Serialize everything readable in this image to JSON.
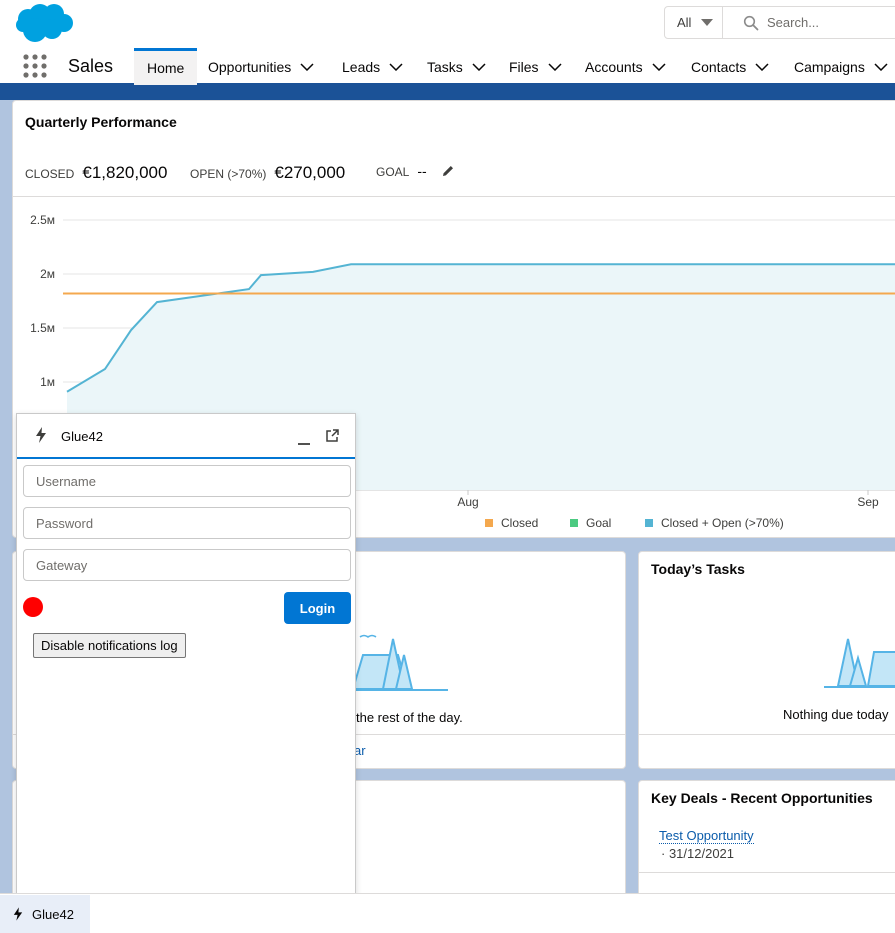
{
  "header": {
    "search_scope": "All",
    "search_placeholder": "Search..."
  },
  "nav": {
    "app_name": "Sales",
    "items": [
      {
        "label": "Home",
        "active": true
      },
      {
        "label": "Opportunities"
      },
      {
        "label": "Leads"
      },
      {
        "label": "Tasks"
      },
      {
        "label": "Files"
      },
      {
        "label": "Accounts"
      },
      {
        "label": "Contacts"
      },
      {
        "label": "Campaigns"
      }
    ]
  },
  "performance": {
    "title": "Quarterly Performance",
    "closed_label": "CLOSED",
    "closed_value": "€1,820,000",
    "open_label": "OPEN (>70%)",
    "open_value": "€270,000",
    "goal_label": "GOAL",
    "goal_value": "--"
  },
  "chart_data": {
    "type": "area",
    "ylim": [
      0,
      2500000
    ],
    "y_ticks": [
      1000000,
      1500000,
      2000000,
      2500000
    ],
    "y_tick_labels": [
      "1м",
      "1.5м",
      "2м",
      "2.5м"
    ],
    "x_tick_labels": [
      "Aug",
      "Sep"
    ],
    "legend": [
      "Closed",
      "Goal",
      "Closed + Open (>70%)"
    ],
    "legend_colors": [
      "#f4a84e",
      "#4bca81",
      "#54b4d3"
    ],
    "series": [
      {
        "name": "Closed",
        "values": [
          1820000,
          1820000
        ]
      },
      {
        "name": "Closed + Open (>70%)",
        "values": [
          910000,
          1120000,
          1480000,
          1740000,
          1860000,
          1990000,
          2020000,
          2090000,
          2090000
        ]
      }
    ]
  },
  "events": {
    "empty_message": "the rest of the day.",
    "footer_link": "ar"
  },
  "tasks": {
    "title": "Today’s Tasks",
    "empty_message": "Nothing due today"
  },
  "deals": {
    "title": "Key Deals - Recent Opportunities",
    "items": [
      {
        "name": "Test Opportunity",
        "date": "· 31/12/2021"
      }
    ]
  },
  "glue": {
    "title": "Glue42",
    "username_placeholder": "Username",
    "password_placeholder": "Password",
    "gateway_placeholder": "Gateway",
    "login_label": "Login",
    "notifications_button": "Disable notifications log",
    "status_color": "#ff0000"
  },
  "utility_bar": {
    "item_label": "Glue42"
  }
}
